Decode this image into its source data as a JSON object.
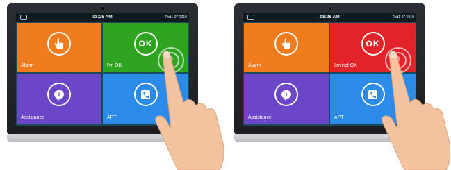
{
  "status_bar": {
    "time": "08:26 AM",
    "day": "Thu",
    "date": "11-07-2019"
  },
  "panels": [
    {
      "tiles": [
        {
          "label": "Alarm",
          "icon": "hand-tap-icon",
          "color": "#f07c1e"
        },
        {
          "label": "I'm OK",
          "icon": "ok-icon",
          "icon_text": "OK",
          "color": "#2ea420"
        },
        {
          "label": "Assistance",
          "icon": "info-chat-icon",
          "icon_text": "i",
          "color": "#6b46c9"
        },
        {
          "label": "APT",
          "icon": "phone-icon",
          "color": "#2c8be8"
        }
      ]
    },
    {
      "tiles": [
        {
          "label": "Alarm",
          "icon": "hand-tap-icon",
          "color": "#f07c1e"
        },
        {
          "label": "I'm not OK",
          "icon": "ok-icon",
          "icon_text": "OK",
          "color": "#e2242a"
        },
        {
          "label": "Assistance",
          "icon": "info-chat-icon",
          "icon_text": "i",
          "color": "#6b46c9"
        },
        {
          "label": "APT",
          "icon": "phone-icon",
          "color": "#2c8be8"
        }
      ]
    }
  ]
}
